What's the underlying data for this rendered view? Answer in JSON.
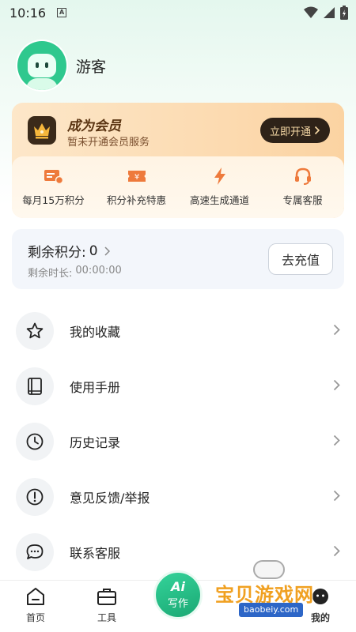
{
  "status_bar": {
    "time": "10:16",
    "notification_icon": "A"
  },
  "profile": {
    "username": "游客"
  },
  "vip": {
    "title": "成为会员",
    "subtitle": "暂未开通会员服务",
    "button_label": "立即开通",
    "perks": [
      {
        "icon": "points-card-icon",
        "label": "每月15万积分"
      },
      {
        "icon": "yen-ticket-icon",
        "label": "积分补充特惠"
      },
      {
        "icon": "lightning-icon",
        "label": "高速生成通道"
      },
      {
        "icon": "headset-icon",
        "label": "专属客服"
      }
    ]
  },
  "points": {
    "label": "剩余积分:",
    "value": "0",
    "time_label": "剩余时长:",
    "time_value": "00:00:00",
    "recharge_label": "去充值"
  },
  "menu": [
    {
      "icon": "star-icon",
      "label": "我的收藏"
    },
    {
      "icon": "book-icon",
      "label": "使用手册"
    },
    {
      "icon": "clock-icon",
      "label": "历史记录"
    },
    {
      "icon": "warning-icon",
      "label": "意见反馈/举报"
    },
    {
      "icon": "chat-icon",
      "label": "联系客服"
    }
  ],
  "bottom_nav": {
    "home": "首页",
    "tools": "工具",
    "write_ai": "Ai",
    "write": "写作",
    "mine": "我的"
  },
  "watermark": {
    "text": "宝贝游戏网",
    "url": "baobeiy.com"
  },
  "colors": {
    "accent": "#1fb47c",
    "vip_bg": "#fbd9ad",
    "vip_button": "#2e2218"
  }
}
